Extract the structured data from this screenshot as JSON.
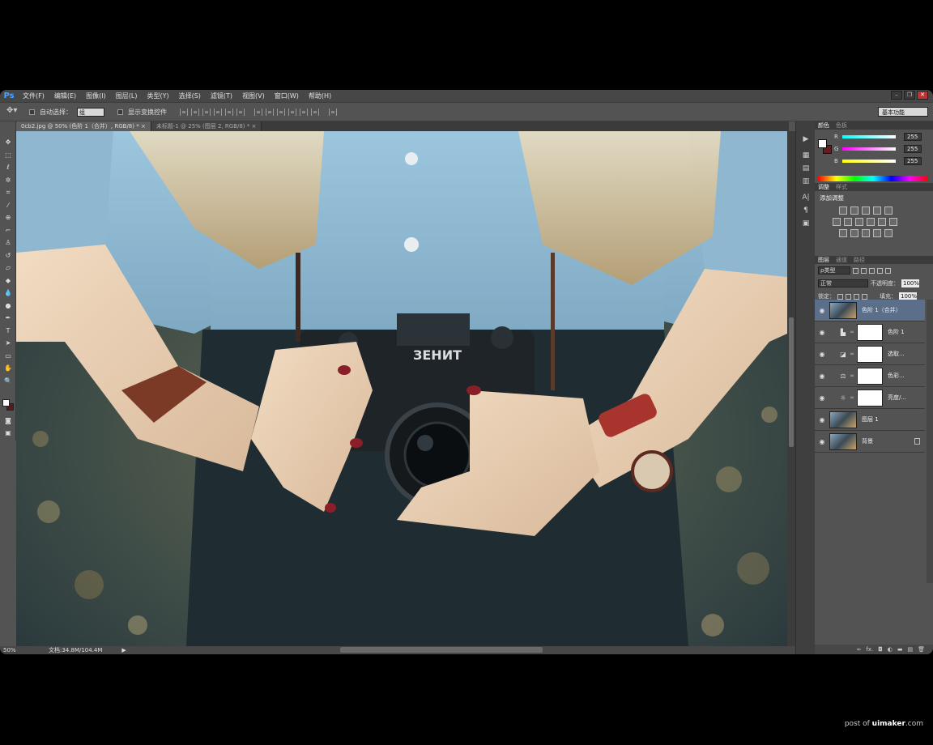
{
  "app": {
    "logo": "Ps"
  },
  "menu": [
    "文件(F)",
    "编辑(E)",
    "图像(I)",
    "图层(L)",
    "类型(Y)",
    "选择(S)",
    "滤镜(T)",
    "视图(V)",
    "窗口(W)",
    "帮助(H)"
  ],
  "window_buttons": {
    "minimize": "–",
    "restore": "❐",
    "close": "✕"
  },
  "options": {
    "auto_select_label": "自动选择：",
    "auto_select_value": "组",
    "show_transform_label": "显示变换控件",
    "workspace": "基本功能"
  },
  "tabs": [
    {
      "label": "0cb2.jpg @ 50% (色阶 1（合并）, RGB/8) *",
      "close": "×"
    },
    {
      "label": "未标题-1 @ 25% (图层 2, RGB/8) *",
      "close": "×"
    }
  ],
  "status": {
    "zoom": "50%",
    "doc_size": "文档:34.8M/104.4M",
    "arrow": "▶"
  },
  "panels": {
    "color_tabs": [
      "颜色",
      "色板"
    ],
    "rgb": [
      {
        "label": "R",
        "value": "255"
      },
      {
        "label": "G",
        "value": "255"
      },
      {
        "label": "B",
        "value": "255"
      }
    ],
    "adjust_tabs": [
      "调整",
      "样式"
    ],
    "adjust_title": "添加调整",
    "layer_tabs": [
      "图层",
      "通道",
      "路径"
    ],
    "filter_kind": "ρ类型",
    "blend_mode": "正常",
    "opacity_label": "不透明度：",
    "opacity_value": "100%",
    "lock_label": "锁定：",
    "fill_label": "填充：",
    "fill_value": "100%",
    "layers": [
      {
        "name": "色阶 1（合并）"
      },
      {
        "name": "色阶 1"
      },
      {
        "name": "选取..."
      },
      {
        "name": "色彩..."
      },
      {
        "name": "亮度/..."
      },
      {
        "name": "图层 1"
      },
      {
        "name": "背景"
      }
    ],
    "footer_icons": [
      "∞",
      "fx.",
      "◘",
      "◐",
      "▬",
      "▤",
      "🗑"
    ]
  },
  "credit": {
    "prefix": "post of ",
    "site": "uimaker",
    "suffix": ".com"
  },
  "colors": {
    "accent": "#4aa3ff",
    "selected_layer": "#5c6f8a"
  }
}
